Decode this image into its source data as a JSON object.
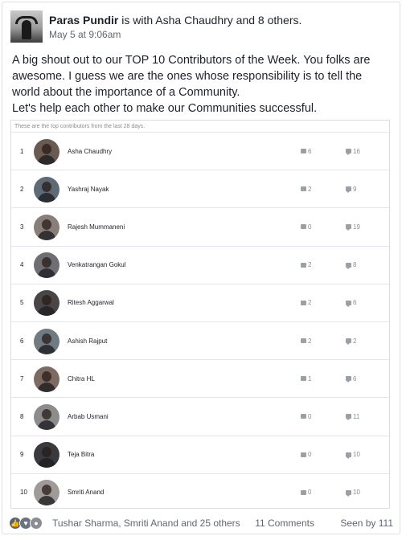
{
  "post": {
    "author": "Paras Pundir",
    "with_text": "is with Asha Chaudhry and 8 others.",
    "timestamp": "May 5 at 9:06am",
    "body": [
      "A big shout out to our TOP 10 Contributors of the Week. You folks are awesome. I guess we are the ones whose responsibility is to tell the world about the importance of a Community.",
      "Let's help each other to make our Communities successful."
    ]
  },
  "card": {
    "caption": "These are the top contributors from the last 28 days.",
    "contributors": [
      {
        "rank": "1",
        "name": "Asha Chaudhry",
        "posts": "6",
        "comments": "16",
        "avatar_color": "#6b5a52"
      },
      {
        "rank": "2",
        "name": "Yashraj Nayak",
        "posts": "2",
        "comments": "9",
        "avatar_color": "#5e6a75"
      },
      {
        "rank": "3",
        "name": "Rajesh Mummaneni",
        "posts": "0",
        "comments": "19",
        "avatar_color": "#8a7f78"
      },
      {
        "rank": "4",
        "name": "Venkatrangan Gokul",
        "posts": "2",
        "comments": "8",
        "avatar_color": "#6f6f73"
      },
      {
        "rank": "5",
        "name": "Ritesh Aggarwal",
        "posts": "2",
        "comments": "6",
        "avatar_color": "#4a4648"
      },
      {
        "rank": "6",
        "name": "Ashish Rajput",
        "posts": "2",
        "comments": "2",
        "avatar_color": "#707a82"
      },
      {
        "rank": "7",
        "name": "Chitra HL",
        "posts": "1",
        "comments": "6",
        "avatar_color": "#7d6a62"
      },
      {
        "rank": "8",
        "name": "Arbab Usmani",
        "posts": "0",
        "comments": "11",
        "avatar_color": "#8c8c8c"
      },
      {
        "rank": "9",
        "name": "Teja Bitra",
        "posts": "0",
        "comments": "10",
        "avatar_color": "#3a3a3e"
      },
      {
        "rank": "10",
        "name": "Smriti Anand",
        "posts": "0",
        "comments": "10",
        "avatar_color": "#a09a98"
      }
    ]
  },
  "footer": {
    "reactions": [
      "like-icon",
      "love-icon",
      "wow-icon"
    ],
    "reactors": "Tushar Sharma, Smriti Anand and 25 others",
    "comments": "11 Comments",
    "seen": "Seen by 111"
  }
}
